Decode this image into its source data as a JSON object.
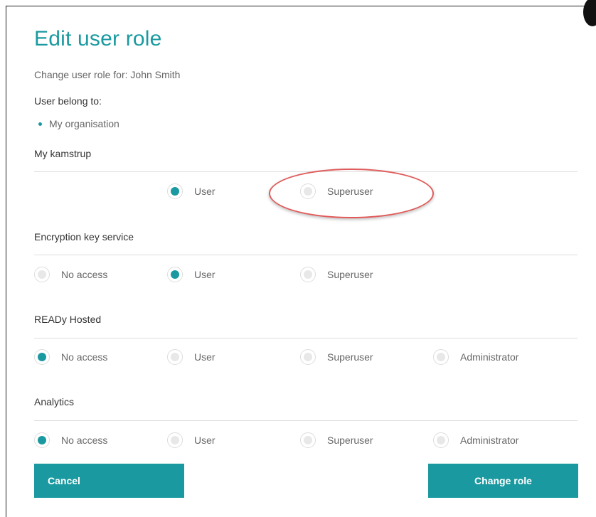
{
  "dialog": {
    "title": "Edit user role",
    "subtitle": "Change user role for: John Smith",
    "belong_label": "User belong to:",
    "organisations": [
      "My organisation"
    ]
  },
  "sections": [
    {
      "label": "My kamstrup",
      "options": [
        {
          "label": "User",
          "checked": true
        },
        {
          "label": "Superuser",
          "checked": false
        }
      ]
    },
    {
      "label": "Encryption key service",
      "options": [
        {
          "label": "No access",
          "checked": false
        },
        {
          "label": "User",
          "checked": true
        },
        {
          "label": "Superuser",
          "checked": false
        }
      ]
    },
    {
      "label": "READy Hosted",
      "options": [
        {
          "label": "No access",
          "checked": true
        },
        {
          "label": "User",
          "checked": false
        },
        {
          "label": "Superuser",
          "checked": false
        },
        {
          "label": "Administrator",
          "checked": false
        }
      ]
    },
    {
      "label": "Analytics",
      "options": [
        {
          "label": "No access",
          "checked": true
        },
        {
          "label": "User",
          "checked": false
        },
        {
          "label": "Superuser",
          "checked": false
        },
        {
          "label": "Administrator",
          "checked": false
        }
      ]
    }
  ],
  "buttons": {
    "cancel": "Cancel",
    "change_role": "Change role"
  },
  "colors": {
    "accent": "#1a9aa0",
    "highlight": "#e05a5a"
  }
}
